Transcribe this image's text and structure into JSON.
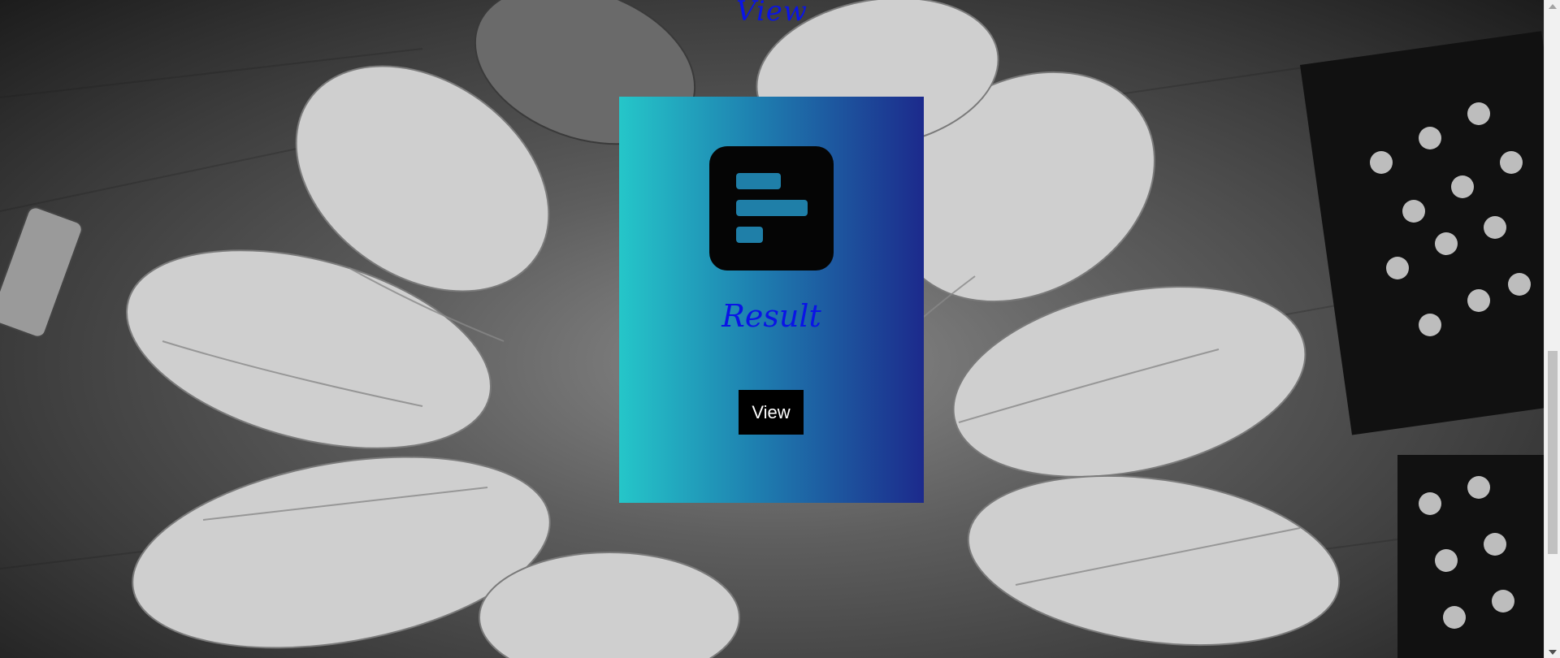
{
  "section": {
    "heading_top": "View"
  },
  "card": {
    "icon": "form-list-icon",
    "title": "Result",
    "button_label": "View"
  },
  "colors": {
    "heading": "#0a14e6",
    "card_gradient_start": "#25c6c9",
    "card_gradient_end": "#1c2a8c",
    "icon_bar": "#1f7fa8",
    "button_bg": "#000000",
    "button_text": "#ffffff"
  },
  "background_image": "black-and-white-photo-of-open-hands-in-circle"
}
